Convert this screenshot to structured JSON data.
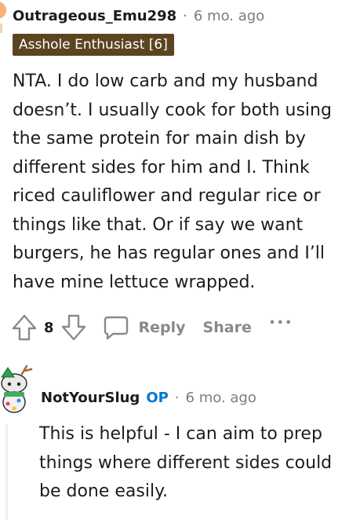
{
  "comment": {
    "username": "Outrageous_Emu298",
    "separator": "·",
    "time_ago": "6 mo. ago",
    "flair": "Asshole Enthusiast [6]",
    "body": "NTA. I do low carb and my husband doesn’t. I usually cook for both using the same protein for main dish by different sides for him and I. Think riced cauliflower and regular rice or things like that. Or if say we want burgers, he has regular ones and I’ll have mine lettuce wrapped.",
    "vote_count": "8",
    "reply_label": "Reply",
    "share_label": "Share",
    "more_label": "•••"
  },
  "reply": {
    "username": "NotYourSlug",
    "op_badge": "OP",
    "separator": "·",
    "time_ago": "6 mo. ago",
    "body": "This is helpful - I can aim to prep things where different sides could be done easily."
  },
  "colors": {
    "flair_bg": "#5c4421",
    "op_blue": "#0079d3",
    "muted_text": "#7c7c7c",
    "action_gray": "#878a8c"
  },
  "icons": [
    "upvote-icon",
    "downvote-icon",
    "comment-icon",
    "more-options-icon",
    "avatar"
  ]
}
